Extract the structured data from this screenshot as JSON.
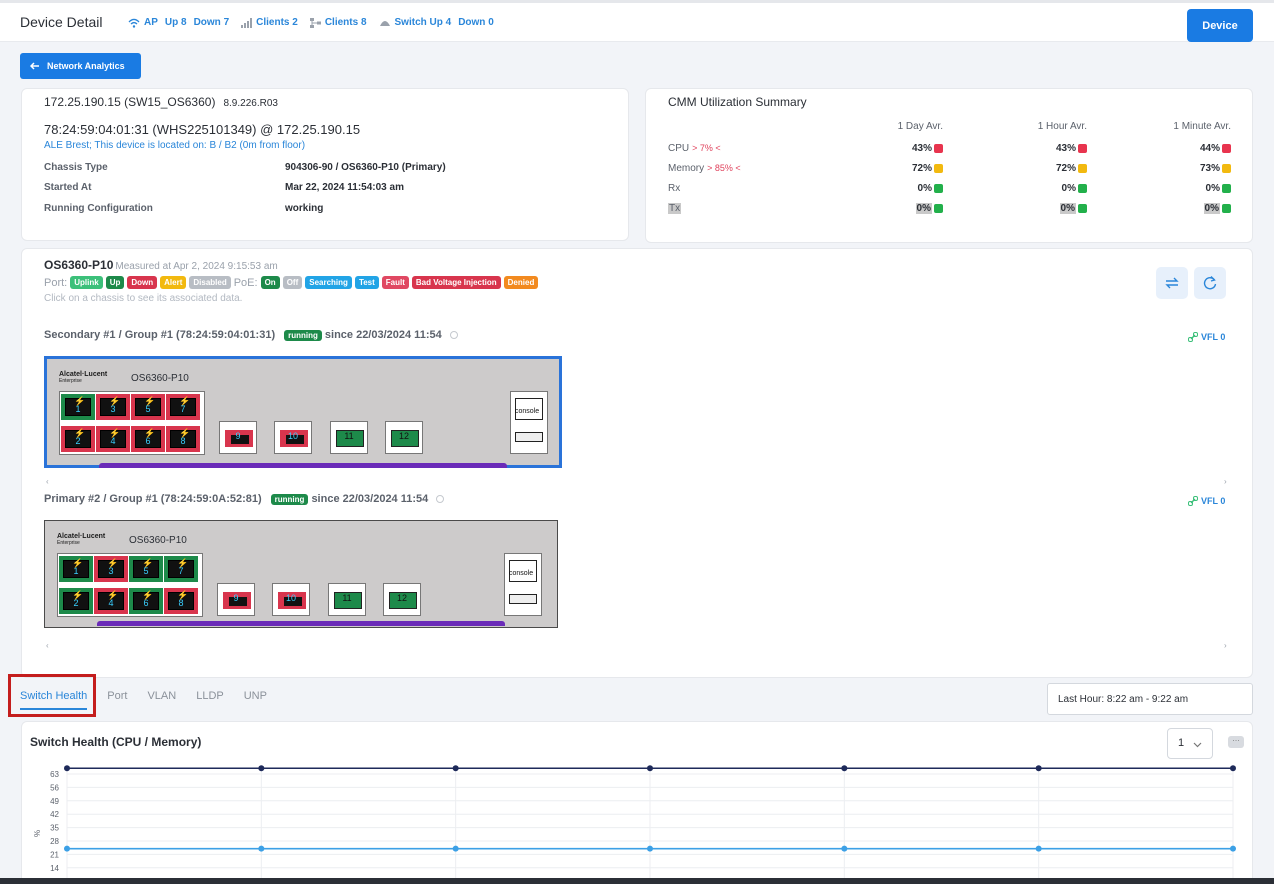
{
  "topbar": {
    "title": "Device Detail",
    "ap_label": "AP",
    "ap_up": "Up 8",
    "ap_down": "Down 7",
    "clients_wifi": "Clients 2",
    "clients_wired": "Clients 8",
    "switch_up": "Switch Up 4",
    "switch_down": "Down 0",
    "device_button": "Device"
  },
  "network_analytics_button": "Network Analytics",
  "device": {
    "ip_name": "172.25.190.15 (SW15_OS6360)",
    "version": "8.9.226.R03",
    "mac_line": "78:24:59:04:01:31 (WHS225101349) @ 172.25.190.15",
    "location": "ALE Brest; This device is located on: B / B2 (0m from floor)",
    "fields": [
      {
        "key": "Chassis Type",
        "value": "904306-90 / OS6360-P10 (Primary)"
      },
      {
        "key": "Started At",
        "value": "Mar 22, 2024 11:54:03 am"
      },
      {
        "key": "Running Configuration",
        "value": "working"
      }
    ]
  },
  "cmm": {
    "title": "CMM Utilization Summary",
    "columns": [
      "1 Day Avr.",
      "1 Hour Avr.",
      "1 Minute Avr."
    ],
    "rows": [
      {
        "label": "CPU",
        "threshold": "> 7% <",
        "values": [
          "43%",
          "43%",
          "44%"
        ],
        "colors": [
          "#e8344e",
          "#e8344e",
          "#e8344e"
        ]
      },
      {
        "label": "Memory",
        "threshold": "> 85% <",
        "values": [
          "72%",
          "72%",
          "73%"
        ],
        "colors": [
          "#f2b90f",
          "#f2b90f",
          "#f2b90f"
        ]
      },
      {
        "label": "Rx",
        "threshold": "",
        "values": [
          "0%",
          "0%",
          "0%"
        ],
        "colors": [
          "#22b04b",
          "#22b04b",
          "#22b04b"
        ]
      },
      {
        "label": "Tx",
        "threshold": "",
        "values": [
          "0%",
          "0%",
          "0%"
        ],
        "colors": [
          "#22b04b",
          "#22b04b",
          "#22b04b"
        ]
      }
    ]
  },
  "chassis_card": {
    "model": "OS6360-P10",
    "measured": "Measured at Apr 2, 2024 9:15:53 am",
    "port_label": "Port:",
    "poe_label": "PoE:",
    "port_tags": [
      {
        "label": "Uplink",
        "color": "#3cc07a"
      },
      {
        "label": "Up",
        "color": "#1d8a4a"
      },
      {
        "label": "Down",
        "color": "#d8354d"
      },
      {
        "label": "Alert",
        "color": "#f2b90f"
      },
      {
        "label": "Disabled",
        "color": "#b8bdc4"
      }
    ],
    "poe_tags": [
      {
        "label": "On",
        "color": "#1d8a4a"
      },
      {
        "label": "Off",
        "color": "#b8bdc4"
      },
      {
        "label": "Searching",
        "color": "#22a4e6"
      },
      {
        "label": "Test",
        "color": "#22a4e6"
      },
      {
        "label": "Fault",
        "color": "#e04862"
      },
      {
        "label": "Bad Voltage Injection",
        "color": "#d8354d"
      },
      {
        "label": "Denied",
        "color": "#f28a1f"
      }
    ],
    "hint": "Click on a chassis to see its associated data.",
    "vfl_label": "VFL 0",
    "chassis": [
      {
        "title": "Secondary #1 / Group #1 (78:24:59:04:01:31)",
        "status": "running",
        "since": "since 22/03/2024 11:54",
        "brand": "Alcatel·Lucent",
        "brand_sub": "Enterprise",
        "model": "OS6360-P10",
        "ports_top": [
          {
            "num": "1",
            "bg": "#1d8a4a"
          },
          {
            "num": "3",
            "bg": "#d8354d"
          },
          {
            "num": "5",
            "bg": "#d8354d"
          },
          {
            "num": "7",
            "bg": "#d8354d"
          }
        ],
        "ports_bottom": [
          {
            "num": "2",
            "bg": "#d8354d"
          },
          {
            "num": "4",
            "bg": "#d8354d"
          },
          {
            "num": "6",
            "bg": "#d8354d"
          },
          {
            "num": "8",
            "bg": "#d8354d"
          }
        ],
        "rj_extra": [
          {
            "num": "9",
            "bg": "#d8354d"
          },
          {
            "num": "10",
            "bg": "#d8354d"
          }
        ],
        "sfp": [
          {
            "num": "11",
            "bg": "#1d8a4a"
          },
          {
            "num": "12",
            "bg": "#1d8a4a"
          }
        ],
        "console": "console"
      },
      {
        "title": "Primary #2 / Group #1 (78:24:59:0A:52:81)",
        "status": "running",
        "since": "since 22/03/2024 11:54",
        "brand": "Alcatel·Lucent",
        "brand_sub": "Enterprise",
        "model": "OS6360-P10",
        "ports_top": [
          {
            "num": "1",
            "bg": "#1d8a4a"
          },
          {
            "num": "3",
            "bg": "#d8354d"
          },
          {
            "num": "5",
            "bg": "#1d8a4a"
          },
          {
            "num": "7",
            "bg": "#1d8a4a"
          }
        ],
        "ports_bottom": [
          {
            "num": "2",
            "bg": "#1d8a4a"
          },
          {
            "num": "4",
            "bg": "#d8354d"
          },
          {
            "num": "6",
            "bg": "#1d8a4a"
          },
          {
            "num": "8",
            "bg": "#d8354d"
          }
        ],
        "rj_extra": [
          {
            "num": "9",
            "bg": "#d8354d"
          },
          {
            "num": "10",
            "bg": "#d8354d"
          }
        ],
        "sfp": [
          {
            "num": "11",
            "bg": "#1d8a4a"
          },
          {
            "num": "12",
            "bg": "#1d8a4a"
          }
        ],
        "console": "console"
      }
    ]
  },
  "tabs": [
    {
      "label": "Switch Health",
      "active": true
    },
    {
      "label": "Port",
      "active": false
    },
    {
      "label": "VLAN",
      "active": false
    },
    {
      "label": "LLDP",
      "active": false
    },
    {
      "label": "UNP",
      "active": false
    }
  ],
  "time_range": "Last Hour: 8:22 am - 9:22 am",
  "health": {
    "title": "Switch Health (CPU / Memory)",
    "select_value": "1"
  },
  "chart_data": {
    "type": "line",
    "ylabel": "%",
    "yticks": [
      63,
      56,
      49,
      42,
      35,
      28,
      21,
      14
    ],
    "ylim": [
      14,
      66
    ],
    "points_per_series": 7,
    "series": [
      {
        "color": "#1e2a5a",
        "values": [
          66,
          66,
          66,
          66,
          66,
          66,
          66
        ]
      },
      {
        "color": "#3ca0e6",
        "values": [
          24,
          24,
          24,
          24,
          24,
          24,
          24
        ]
      }
    ]
  }
}
